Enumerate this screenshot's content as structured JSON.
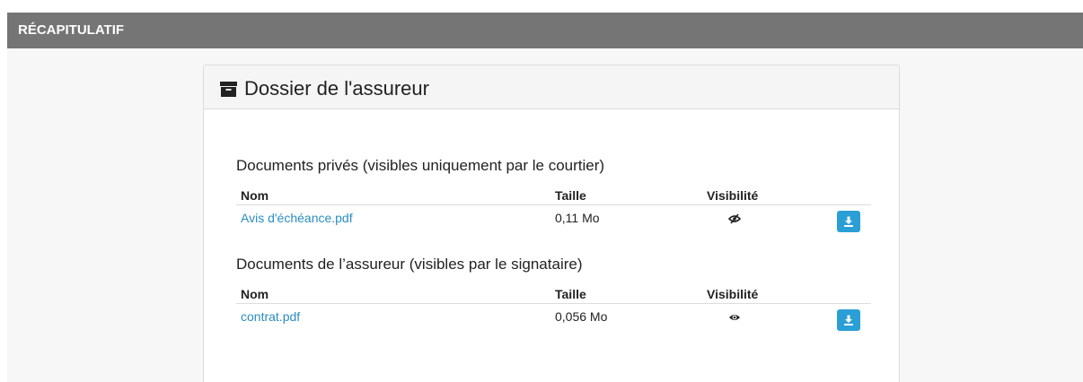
{
  "header": {
    "title": "RÉCAPITULATIF"
  },
  "panel": {
    "title": "Dossier de l'assureur",
    "icon": "archive-icon"
  },
  "sections": [
    {
      "title": "Documents privés (visibles uniquement par le courtier)",
      "columns": {
        "name": "Nom",
        "size": "Taille",
        "visibility": "Visibilité"
      },
      "rows": [
        {
          "name": "Avis d'échéance.pdf",
          "size": "0,11 Mo",
          "visibility_icon": "eye-slash-icon",
          "action_icon": "download-icon"
        }
      ]
    },
    {
      "title": "Documents de l’assureur (visibles par le signataire)",
      "columns": {
        "name": "Nom",
        "size": "Taille",
        "visibility": "Visibilité"
      },
      "rows": [
        {
          "name": "contrat.pdf",
          "size": "0,056 Mo",
          "visibility_icon": "eye-icon",
          "action_icon": "download-icon"
        }
      ]
    }
  ],
  "colors": {
    "header_bar": "#757575",
    "link": "#2a8ec0",
    "button": "#2a9fd6"
  }
}
